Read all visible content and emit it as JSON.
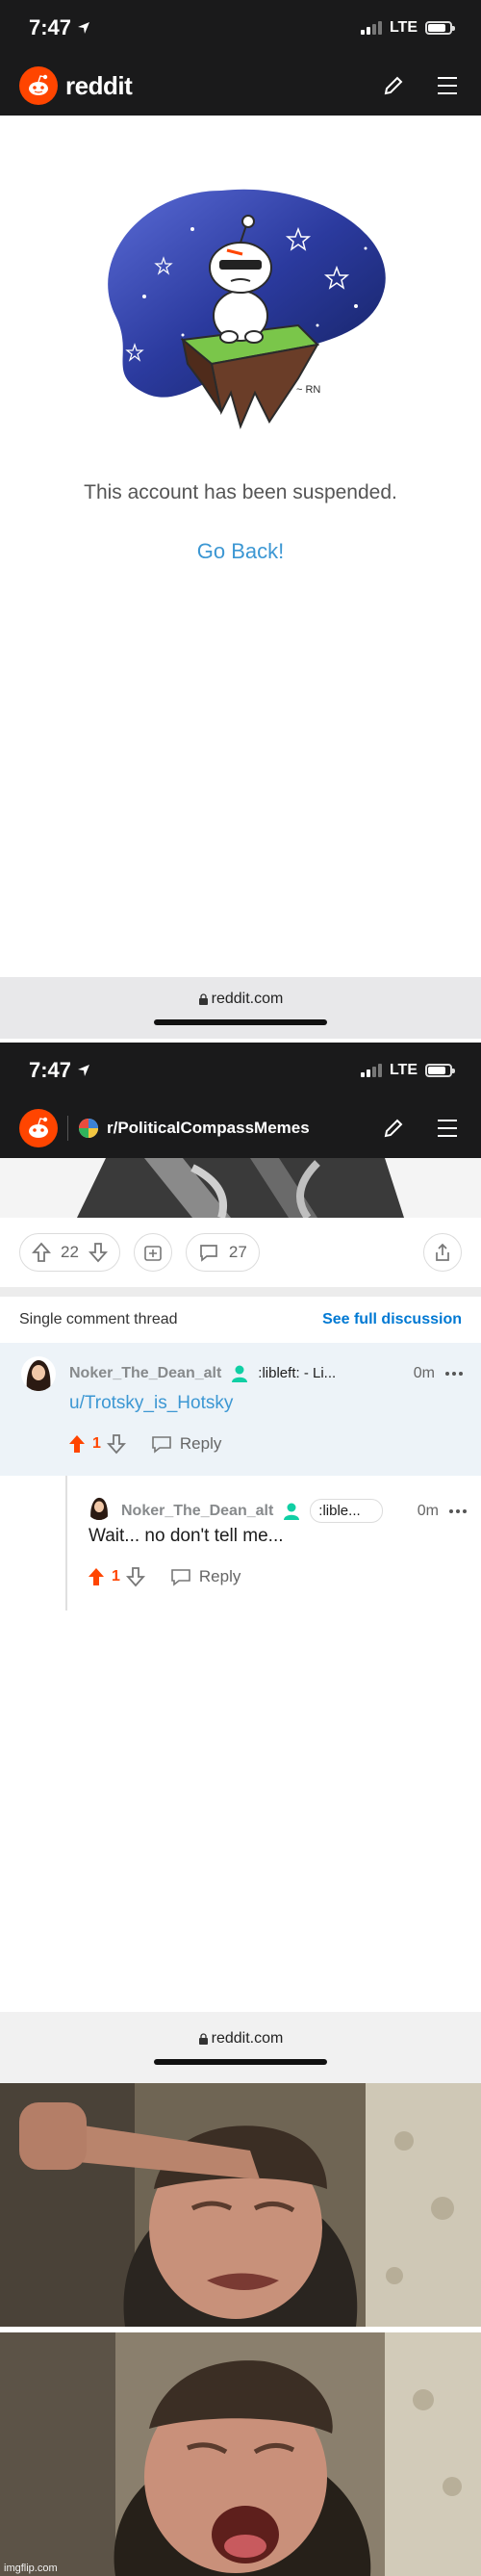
{
  "screen1": {
    "status": {
      "time": "7:47",
      "network": "LTE"
    },
    "brand": "reddit",
    "suspended_message": "This account has been suspended.",
    "go_back_label": "Go Back!",
    "illustration_signature": "~ RN",
    "url": "reddit.com"
  },
  "screen2": {
    "status": {
      "time": "7:47",
      "network": "LTE"
    },
    "subreddit": "r/PoliticalCompassMemes",
    "post_actions": {
      "votes": "22",
      "comments": "27"
    },
    "thread_label": "Single comment thread",
    "see_full_label": "See full discussion",
    "comments": [
      {
        "username": "Noker_The_Dean_alt",
        "flair": ":libleft: - Li...",
        "time": "0m",
        "body": "u/Trotsky_is_Hotsky",
        "score": "1",
        "reply_label": "Reply"
      },
      {
        "username": "Noker_The_Dean_alt",
        "flair": ":lible...",
        "time": "0m",
        "body": "Wait... no don't tell me...",
        "score": "1",
        "reply_label": "Reply"
      }
    ],
    "url": "reddit.com"
  },
  "watermark": "imgflip.com",
  "colors": {
    "reddit_orange": "#ff4500",
    "link_blue": "#3c97d3",
    "navbar_dark": "#1a1a1b",
    "highlight_bg": "#edf3f8",
    "mod_green": "#10cfa4"
  },
  "icons": [
    "location-arrow-icon",
    "signal-icon",
    "battery-icon",
    "snoo-logo-icon",
    "pencil-icon",
    "menu-icon",
    "lock-icon",
    "upvote-icon",
    "downvote-icon",
    "award-icon",
    "comment-icon",
    "share-icon",
    "more-icon",
    "reply-icon",
    "user-badge-icon"
  ]
}
